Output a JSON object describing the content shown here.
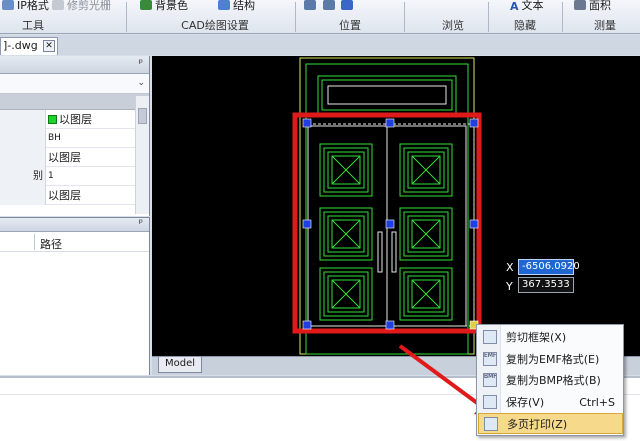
{
  "ribbon": {
    "items": [
      {
        "label": "IP格式",
        "icon": "format-icon"
      },
      {
        "label": "修剪光栅",
        "icon": "trim-raster-icon"
      },
      {
        "label": "背景色",
        "icon": "background-color-icon"
      },
      {
        "label": "结构",
        "icon": "structure-icon"
      },
      {
        "label": "文本",
        "icon": "text-icon"
      },
      {
        "label": "面积",
        "icon": "area-icon"
      }
    ],
    "groups": [
      "工具",
      "CAD绘图设置",
      "位置",
      "浏览",
      "隐藏",
      "测量"
    ]
  },
  "document_tab": {
    "label": "]-.dwg",
    "close": "✕"
  },
  "properties_panel": {
    "pin": "ᵖ",
    "combo_arrow": "⌄",
    "rows": [
      {
        "key": "",
        "value": "以图层",
        "swatch": true
      },
      {
        "key": "",
        "value": "BH",
        "small": true
      },
      {
        "key": "",
        "value": "以图层"
      },
      {
        "key": "别",
        "value": "1",
        "small": true
      },
      {
        "key": "",
        "value": "以图层"
      }
    ]
  },
  "file_panel": {
    "pin": "ᵖ",
    "column": "路径"
  },
  "model_tab": "Model",
  "coordinates": {
    "x_label": "X",
    "x_value": "-6506.0920",
    "y_label": "Y",
    "y_value": "367.3533"
  },
  "context_menu": {
    "items": [
      {
        "label": "剪切框架(X)",
        "shortcut": "",
        "icon": "cut-frame-icon",
        "icon_text": ""
      },
      {
        "label": "复制为EMF格式(E)",
        "shortcut": "",
        "icon": "copy-emf-icon",
        "icon_text": "EMF"
      },
      {
        "label": "复制为BMP格式(B)",
        "shortcut": "",
        "icon": "copy-bmp-icon",
        "icon_text": "BMP"
      },
      {
        "label": "保存(V)",
        "shortcut": "Ctrl+S",
        "icon": "save-icon",
        "icon_text": ""
      },
      {
        "label": "多页打印(Z)",
        "shortcut": "",
        "icon": "print-icon",
        "icon_text": ""
      }
    ],
    "highlighted_index": 4
  },
  "colors": {
    "drawing_lines": "#32e03a",
    "selection_box": "#e01a1a",
    "grips": "#1f3fe0",
    "annotation_arrow": "#e01a1a"
  }
}
